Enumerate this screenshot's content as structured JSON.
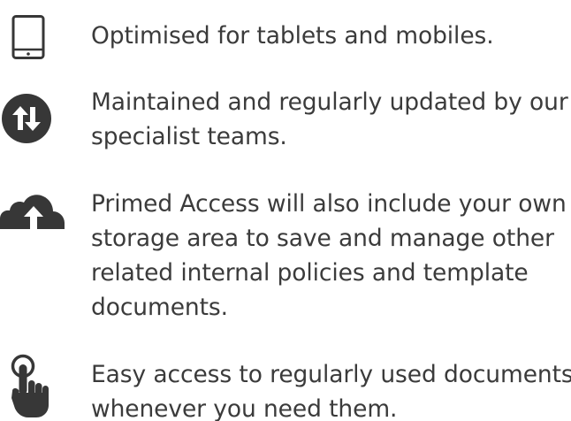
{
  "colors": {
    "icon": "#373737",
    "text": "#3b3b3b",
    "background": "#ffffff"
  },
  "features": [
    {
      "icon": "tablet-icon",
      "lines": [
        "Optimised for tablets and mobiles."
      ]
    },
    {
      "icon": "sync-arrows-icon",
      "lines": [
        "Maintained and regularly updated by our",
        "specialist teams."
      ]
    },
    {
      "icon": "cloud-upload-icon",
      "lines": [
        "Primed Access will also include your own",
        "storage area to save and manage other",
        "related internal policies and template",
        "documents."
      ]
    },
    {
      "icon": "touch-pointer-icon",
      "lines": [
        "Easy access to regularly used documents",
        "whenever you need them."
      ]
    }
  ]
}
